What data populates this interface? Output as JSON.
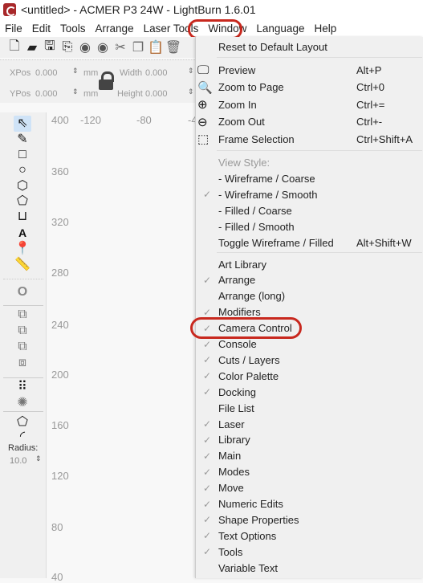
{
  "window": {
    "title": "<untitled> - ACMER P3 24W - LightBurn 1.6.01"
  },
  "menubar": [
    "File",
    "Edit",
    "Tools",
    "Arrange",
    "Laser Tools",
    "Window",
    "Language",
    "Help"
  ],
  "numeric": {
    "xpos_label": "XPos",
    "xpos": "0.000",
    "ypos_label": "YPos",
    "ypos": "0.000",
    "unit": "mm",
    "width_label": "Width",
    "width": "0.000",
    "height_label": "Height",
    "height": "0.000"
  },
  "tools": {
    "radius_label": "Radius:",
    "radius_value": "10.0"
  },
  "ruler": {
    "vertical": [
      "400",
      "360",
      "320",
      "280",
      "240",
      "200",
      "160",
      "120",
      "80",
      "40"
    ],
    "horizontal": [
      "-120",
      "-80",
      "-4"
    ]
  },
  "highlight_color": "#c8281e",
  "menu": {
    "reset": "Reset to Default Layout",
    "view": [
      {
        "icon": "monitor-icon",
        "label": "Preview",
        "shortcut": "Alt+P"
      },
      {
        "icon": "zoom-page-icon",
        "label": "Zoom to Page",
        "shortcut": "Ctrl+0"
      },
      {
        "icon": "zoom-in-icon",
        "label": "Zoom In",
        "shortcut": "Ctrl+="
      },
      {
        "icon": "zoom-out-icon",
        "label": "Zoom Out",
        "shortcut": "Ctrl+-"
      },
      {
        "icon": "frame-selection-icon",
        "label": "Frame Selection",
        "shortcut": "Ctrl+Shift+A"
      }
    ],
    "view_style_header": "View Style:",
    "styles": [
      {
        "label": "-  Wireframe / Coarse",
        "checked": false
      },
      {
        "label": "-  Wireframe / Smooth",
        "checked": true
      },
      {
        "label": "-  Filled / Coarse",
        "checked": false
      },
      {
        "label": "-  Filled / Smooth",
        "checked": false
      }
    ],
    "toggle": {
      "label": "Toggle Wireframe / Filled",
      "shortcut": "Alt+Shift+W"
    },
    "panels": [
      {
        "label": "Art Library",
        "checked": false
      },
      {
        "label": "Arrange",
        "checked": true
      },
      {
        "label": "Arrange (long)",
        "checked": false
      },
      {
        "label": "Modifiers",
        "checked": true
      },
      {
        "label": "Camera Control",
        "checked": true
      },
      {
        "label": "Console",
        "checked": true
      },
      {
        "label": "Cuts / Layers",
        "checked": true
      },
      {
        "label": "Color Palette",
        "checked": true
      },
      {
        "label": "Docking",
        "checked": true
      },
      {
        "label": "File List",
        "checked": false
      },
      {
        "label": "Laser",
        "checked": true
      },
      {
        "label": "Library",
        "checked": true
      },
      {
        "label": "Main",
        "checked": true
      },
      {
        "label": "Modes",
        "checked": true
      },
      {
        "label": "Move",
        "checked": true
      },
      {
        "label": "Numeric Edits",
        "checked": true
      },
      {
        "label": "Shape Properties",
        "checked": true
      },
      {
        "label": "Text Options",
        "checked": true
      },
      {
        "label": "Tools",
        "checked": true
      },
      {
        "label": "Variable Text",
        "checked": false
      }
    ],
    "check_glyph": "✓"
  }
}
